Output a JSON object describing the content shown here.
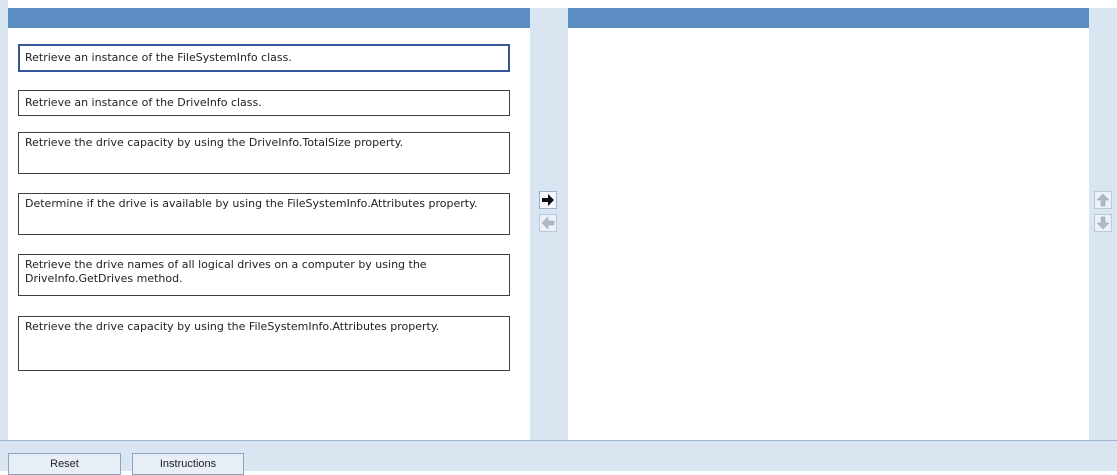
{
  "source_list": {
    "items": [
      {
        "text": "Retrieve an instance of the FileSystemInfo class."
      },
      {
        "text": "Retrieve an instance of the DriveInfo class."
      },
      {
        "text": "Retrieve the drive capacity by using the DriveInfo.TotalSize property."
      },
      {
        "text": "Determine if the drive is available by using the FileSystemInfo.Attributes property."
      },
      {
        "text": "Retrieve the drive names of all logical drives on a computer by using the DriveInfo.GetDrives method."
      },
      {
        "text": "Retrieve the drive capacity by using the FileSystemInfo.Attributes property."
      }
    ]
  },
  "target_list": {
    "items": []
  },
  "controls": {
    "move_right_icon": "arrow-right-icon",
    "move_left_icon": "arrow-left-icon",
    "move_up_icon": "arrow-up-icon",
    "move_down_icon": "arrow-down-icon"
  },
  "footer": {
    "reset_label": "Reset",
    "instructions_label": "Instructions"
  },
  "colors": {
    "header_blue": "#5b8cc2",
    "gutter": "#d9e6f2",
    "selected_border": "#34579a"
  }
}
